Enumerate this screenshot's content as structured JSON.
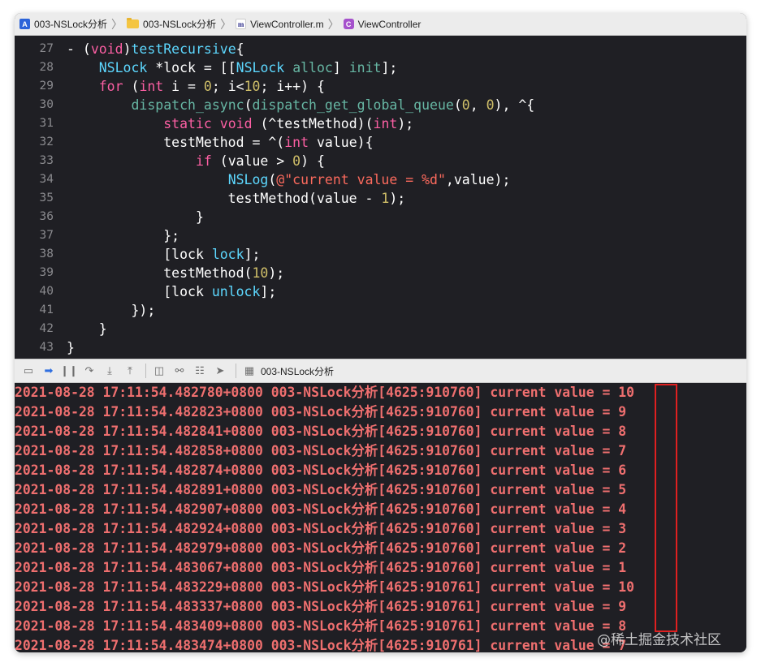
{
  "breadcrumbs": [
    {
      "label": "003-NSLock分析",
      "icon": "project-icon"
    },
    {
      "label": "003-NSLock分析",
      "icon": "folder-icon"
    },
    {
      "label": "ViewController.m",
      "icon": "objc-file-icon"
    },
    {
      "label": "ViewController",
      "icon": "class-icon"
    }
  ],
  "code_lines": [
    {
      "n": "27",
      "tokens": [
        [
          "plain",
          "- ("
        ],
        [
          "kw",
          "void"
        ],
        [
          "plain",
          ")"
        ],
        [
          "tp",
          "testRecursive"
        ],
        [
          "plain",
          "{"
        ]
      ]
    },
    {
      "n": "28",
      "tokens": [
        [
          "plain",
          "    "
        ],
        [
          "tp",
          "NSLock"
        ],
        [
          "plain",
          " *lock = [["
        ],
        [
          "tp",
          "NSLock"
        ],
        [
          "plain",
          " "
        ],
        [
          "fn",
          "alloc"
        ],
        [
          "plain",
          "] "
        ],
        [
          "fn",
          "init"
        ],
        [
          "plain",
          "];"
        ]
      ]
    },
    {
      "n": "29",
      "tokens": [
        [
          "plain",
          "    "
        ],
        [
          "kw",
          "for"
        ],
        [
          "plain",
          " ("
        ],
        [
          "kw",
          "int"
        ],
        [
          "plain",
          " i = "
        ],
        [
          "num",
          "0"
        ],
        [
          "plain",
          "; i<"
        ],
        [
          "num",
          "10"
        ],
        [
          "plain",
          "; i++) {"
        ]
      ]
    },
    {
      "n": "30",
      "tokens": [
        [
          "plain",
          "        "
        ],
        [
          "fn",
          "dispatch_async"
        ],
        [
          "plain",
          "("
        ],
        [
          "fn",
          "dispatch_get_global_queue"
        ],
        [
          "plain",
          "("
        ],
        [
          "num",
          "0"
        ],
        [
          "plain",
          ", "
        ],
        [
          "num",
          "0"
        ],
        [
          "plain",
          "), ^{"
        ]
      ]
    },
    {
      "n": "31",
      "tokens": [
        [
          "plain",
          "            "
        ],
        [
          "kw",
          "static"
        ],
        [
          "plain",
          " "
        ],
        [
          "kw",
          "void"
        ],
        [
          "plain",
          " (^testMethod)("
        ],
        [
          "kw",
          "int"
        ],
        [
          "plain",
          ");"
        ]
      ]
    },
    {
      "n": "32",
      "tokens": [
        [
          "plain",
          "            testMethod = ^("
        ],
        [
          "kw",
          "int"
        ],
        [
          "plain",
          " value){"
        ]
      ]
    },
    {
      "n": "33",
      "tokens": [
        [
          "plain",
          "                "
        ],
        [
          "kw",
          "if"
        ],
        [
          "plain",
          " (value > "
        ],
        [
          "num",
          "0"
        ],
        [
          "plain",
          ") {"
        ]
      ]
    },
    {
      "n": "34",
      "tokens": [
        [
          "plain",
          "                    "
        ],
        [
          "tp",
          "NSLog"
        ],
        [
          "plain",
          "("
        ],
        [
          "str",
          "@\"current value = %d\""
        ],
        [
          "plain",
          ",value);"
        ]
      ]
    },
    {
      "n": "35",
      "tokens": [
        [
          "plain",
          "                    testMethod(value - "
        ],
        [
          "num",
          "1"
        ],
        [
          "plain",
          ");"
        ]
      ]
    },
    {
      "n": "36",
      "tokens": [
        [
          "plain",
          "                }"
        ]
      ]
    },
    {
      "n": "37",
      "tokens": [
        [
          "plain",
          "            };"
        ]
      ]
    },
    {
      "n": "38",
      "tokens": [
        [
          "plain",
          "            [lock "
        ],
        [
          "tp",
          "lock"
        ],
        [
          "plain",
          "];"
        ]
      ]
    },
    {
      "n": "39",
      "tokens": [
        [
          "plain",
          "            testMethod("
        ],
        [
          "num",
          "10"
        ],
        [
          "plain",
          ");"
        ]
      ]
    },
    {
      "n": "40",
      "tokens": [
        [
          "plain",
          "            [lock "
        ],
        [
          "tp",
          "unlock"
        ],
        [
          "plain",
          "];"
        ]
      ]
    },
    {
      "n": "41",
      "tokens": [
        [
          "plain",
          "        });"
        ]
      ]
    },
    {
      "n": "42",
      "tokens": [
        [
          "plain",
          "    }"
        ]
      ]
    },
    {
      "n": "43",
      "tokens": [
        [
          "plain",
          "}"
        ]
      ]
    }
  ],
  "debug_toolbar": {
    "target_label": "003-NSLock分析",
    "buttons": [
      "hide-debug-area",
      "breakpoints-toggle",
      "pause",
      "step-over",
      "step-into",
      "step-out",
      "view-hierarchy",
      "memory-graph",
      "environment-overrides",
      "simulate-location"
    ]
  },
  "console_lines": [
    "2021-08-28 17:11:54.482780+0800 003-NSLock分析[4625:910760] current value = 10",
    "2021-08-28 17:11:54.482823+0800 003-NSLock分析[4625:910760] current value = 9",
    "2021-08-28 17:11:54.482841+0800 003-NSLock分析[4625:910760] current value = 8",
    "2021-08-28 17:11:54.482858+0800 003-NSLock分析[4625:910760] current value = 7",
    "2021-08-28 17:11:54.482874+0800 003-NSLock分析[4625:910760] current value = 6",
    "2021-08-28 17:11:54.482891+0800 003-NSLock分析[4625:910760] current value = 5",
    "2021-08-28 17:11:54.482907+0800 003-NSLock分析[4625:910760] current value = 4",
    "2021-08-28 17:11:54.482924+0800 003-NSLock分析[4625:910760] current value = 3",
    "2021-08-28 17:11:54.482979+0800 003-NSLock分析[4625:910760] current value = 2",
    "2021-08-28 17:11:54.483067+0800 003-NSLock分析[4625:910760] current value = 1",
    "2021-08-28 17:11:54.483229+0800 003-NSLock分析[4625:910761] current value = 10",
    "2021-08-28 17:11:54.483337+0800 003-NSLock分析[4625:910761] current value = 9",
    "2021-08-28 17:11:54.483409+0800 003-NSLock分析[4625:910761] current value = 8",
    "2021-08-28 17:11:54.483474+0800 003-NSLock分析[4625:910761] current value = 7"
  ],
  "watermark": "@稀土掘金技术社区",
  "colors": {
    "editor_bg": "#1f1f24",
    "keyword": "#fc5fa3",
    "type": "#5dd8ff",
    "function": "#67b7a4",
    "number": "#d0bf69",
    "string": "#fc6a5d",
    "console_text": "#ef6f6f",
    "highlight_box": "#e02020"
  }
}
